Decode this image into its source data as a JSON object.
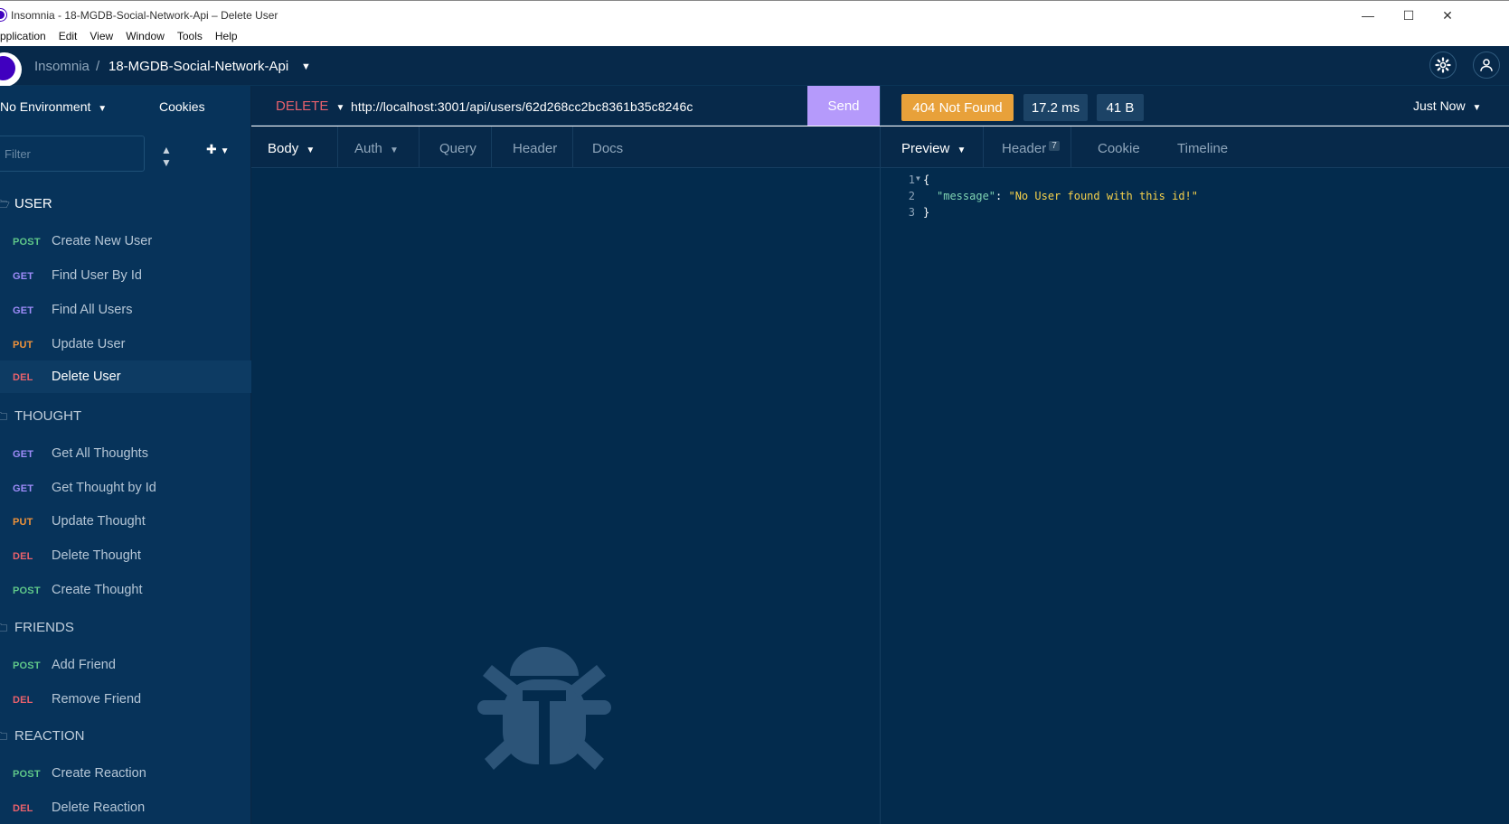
{
  "window": {
    "title": "Insomnia - 18-MGDB-Social-Network-Api – Delete User",
    "controls": [
      "minimize-icon",
      "maximize-icon",
      "close-icon"
    ]
  },
  "menu": [
    "Application",
    "Edit",
    "View",
    "Window",
    "Tools",
    "Help"
  ],
  "menu_visible_first": "pplication",
  "header": {
    "app_name": "Insomnia",
    "separator": "/",
    "workspace": "18-MGDB-Social-Network-Api",
    "icons": [
      "gear-icon",
      "user-icon"
    ]
  },
  "sidebar": {
    "environment": "No Environment",
    "cookies": "Cookies",
    "filter_placeholder": "Filter",
    "groups": [
      {
        "name": "USER",
        "items": [
          {
            "method": "POST",
            "label": "Create New User"
          },
          {
            "method": "GET",
            "label": "Find User By Id"
          },
          {
            "method": "GET",
            "label": "Find All Users"
          },
          {
            "method": "PUT",
            "label": "Update User"
          },
          {
            "method": "DEL",
            "label": "Delete User"
          }
        ]
      },
      {
        "name": "THOUGHT",
        "items": [
          {
            "method": "GET",
            "label": "Get All Thoughts"
          },
          {
            "method": "GET",
            "label": "Get Thought by Id"
          },
          {
            "method": "PUT",
            "label": "Update Thought"
          },
          {
            "method": "DEL",
            "label": "Delete Thought"
          },
          {
            "method": "POST",
            "label": "Create Thought"
          }
        ]
      },
      {
        "name": "FRIENDS",
        "items": [
          {
            "method": "POST",
            "label": "Add Friend"
          },
          {
            "method": "DEL",
            "label": "Remove Friend"
          }
        ]
      },
      {
        "name": "REACTION",
        "items": [
          {
            "method": "POST",
            "label": "Create Reaction"
          },
          {
            "method": "DEL",
            "label": "Delete Reaction"
          }
        ]
      }
    ]
  },
  "request": {
    "method": "DELETE",
    "url": "http://localhost:3001/api/users/62d268cc2bc8361b35c8246c",
    "send": "Send",
    "tabs": [
      "Body",
      "Auth",
      "Query",
      "Header",
      "Docs"
    ]
  },
  "response": {
    "status": "404 Not Found",
    "time": "17.2 ms",
    "size": "41 B",
    "history": "Just Now",
    "tabs": [
      "Preview",
      "Header",
      "Cookie",
      "Timeline"
    ],
    "header_count": "7",
    "lines": [
      "1",
      "2",
      "3"
    ],
    "json": {
      "open": "{",
      "key": "\"message\"",
      "colon": ": ",
      "value": "\"No User found with this id!\"",
      "close": "}"
    }
  },
  "colors": {
    "post": "#5fc789",
    "get": "#9e8cf9",
    "put": "#f0933a",
    "del": "#e8616c",
    "status_404": "#e8a13a",
    "send": "#b59afb"
  }
}
